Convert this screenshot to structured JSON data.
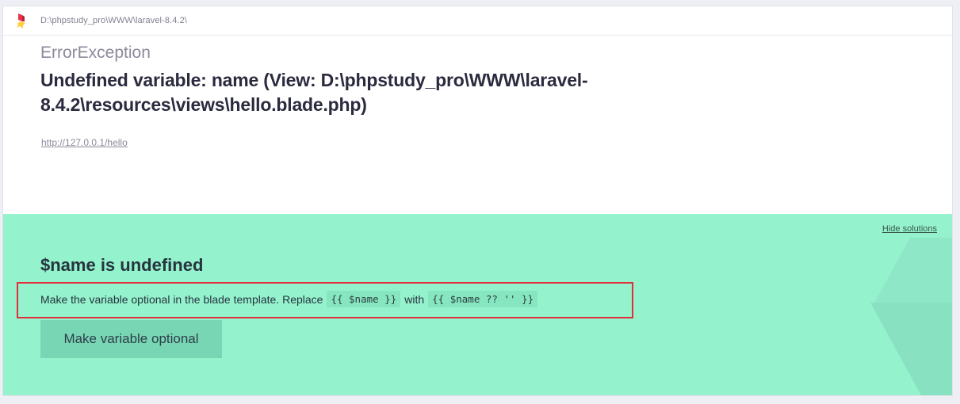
{
  "topbar": {
    "app_path": "D:\\phpstudy_pro\\WWW\\laravel-8.4.2\\",
    "logo_icon": "ignition-logo-icon"
  },
  "error": {
    "exception_class": "ErrorException",
    "message": "Undefined variable: name (View: D:\\phpstudy_pro\\WWW\\laravel-8.4.2\\resources\\views\\hello.blade.php)",
    "url": "http://127.0.0.1/hello"
  },
  "solution": {
    "hide_label": "Hide solutions",
    "title": "$name is undefined",
    "desc_prefix": "Make the variable optional in the blade template. Replace",
    "code_from": "{{ $name }}",
    "desc_with": "with",
    "code_to": "{{ $name ?? '' }}",
    "action_label": "Make variable optional"
  },
  "colors": {
    "solution_bg": "#94f2cd",
    "button_bg": "#78d6b4",
    "highlight_border": "#e0303a"
  }
}
